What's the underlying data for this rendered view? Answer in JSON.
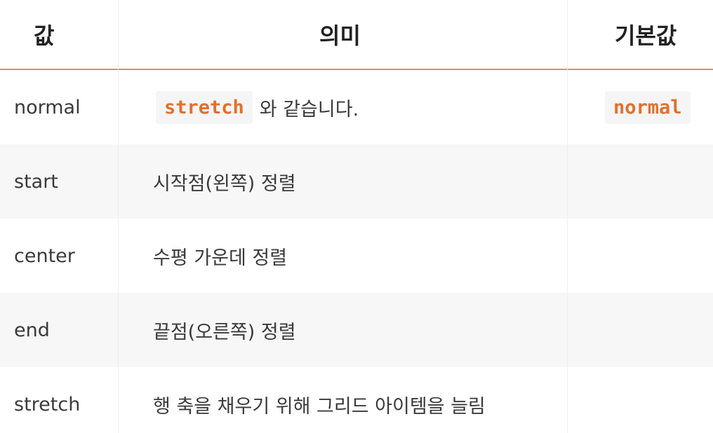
{
  "header": {
    "col_value": "값",
    "col_meaning": "의미",
    "col_default": "기본값"
  },
  "rows": [
    {
      "value": "normal",
      "meaning_code": "stretch",
      "meaning_text": "와 같습니다.",
      "default_code": "normal"
    },
    {
      "value": "start",
      "meaning": "시작점(왼쪽) 정렬"
    },
    {
      "value": "center",
      "meaning": "수평 가운데 정렬"
    },
    {
      "value": "end",
      "meaning": "끝점(오른쪽) 정렬"
    },
    {
      "value": "stretch",
      "meaning": "행 축을 채우기 위해 그리드 아이템을 늘림"
    }
  ],
  "colors": {
    "accent": "#e88a4e",
    "code": "#e0702f",
    "row_alt": "#f7f7f7"
  }
}
